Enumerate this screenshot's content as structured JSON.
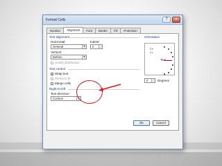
{
  "dialog": {
    "title": "Format Cells",
    "close_glyph": "x",
    "help_glyph": "?",
    "tabs": [
      {
        "label": "Number"
      },
      {
        "label": "Alignment"
      },
      {
        "label": "Font"
      },
      {
        "label": "Border"
      },
      {
        "label": "Fill"
      },
      {
        "label": "Protection"
      }
    ],
    "text_alignment": {
      "section_label": "Text alignment",
      "horizontal_label": "Horizontal:",
      "horizontal_value": "General",
      "indent_label": "Indent:",
      "indent_value": "0",
      "vertical_label": "Vertical:",
      "vertical_value": "Bottom",
      "justify_distributed_label": "Justify distributed"
    },
    "text_control": {
      "section_label": "Text control",
      "wrap_text": {
        "label": "Wrap text",
        "checked": true
      },
      "shrink_to_fit": {
        "label": "Shrink to fit",
        "checked": false
      },
      "merge_cells": {
        "label": "Merge cells",
        "checked": false
      }
    },
    "right_to_left": {
      "section_label": "Right-to-left",
      "direction_label": "Text direction:",
      "direction_value": "Context"
    },
    "orientation": {
      "section_label": "Orientation",
      "vertical_letters": "T e x t",
      "text_label": "Text",
      "degrees_value": "0",
      "degrees_label": "Degrees"
    },
    "buttons": {
      "ok": "OK",
      "cancel": "Cancel"
    }
  },
  "annotation": {
    "color": "#e01818"
  }
}
